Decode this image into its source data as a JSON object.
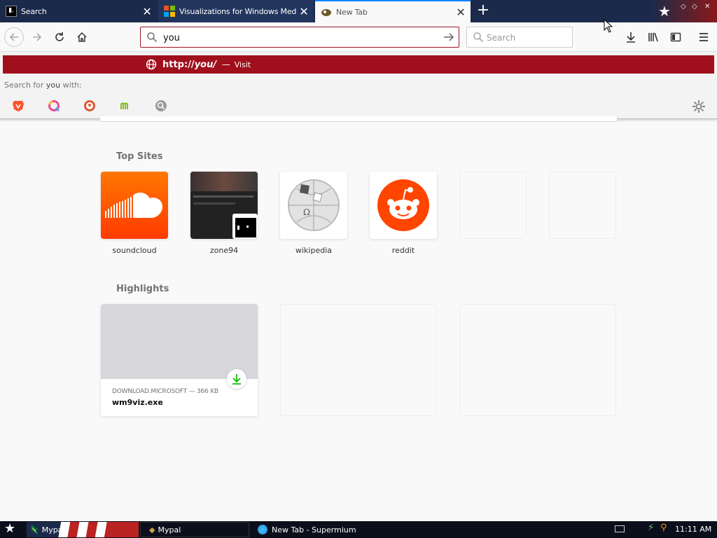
{
  "tabs": [
    {
      "title": "Search",
      "icon": "terminal-icon"
    },
    {
      "title": "Visualizations for Windows Media Player",
      "icon": "windows-logo-icon"
    },
    {
      "title": "New Tab",
      "icon": "browser-icon"
    }
  ],
  "urlbar": {
    "value": "you"
  },
  "searchbar": {
    "placeholder": "Search"
  },
  "dropdown": {
    "visit_url_prefix": "http://",
    "visit_url_bold": "you/",
    "visit_sep": " — ",
    "visit_label": "Visit",
    "search_for_prefix": "Search for ",
    "search_for_term": "you",
    "search_for_suffix": " with:",
    "engines": [
      "brave-icon",
      "qwant-icon",
      "duckduckgo-icon",
      "mojeek-icon",
      "magnifier-engine-icon"
    ]
  },
  "top_sites": {
    "title": "Top Sites",
    "items": [
      {
        "label": "soundcloud"
      },
      {
        "label": "zone94"
      },
      {
        "label": "wikipedia"
      },
      {
        "label": "reddit"
      },
      {
        "label": ""
      },
      {
        "label": ""
      }
    ]
  },
  "highlights": {
    "title": "Highlights",
    "item": {
      "source": "DOWNLOAD.MICROSOFT — 366 KB",
      "title": "wm9viz.exe"
    }
  },
  "taskbar": {
    "items": [
      {
        "label": "Mypal"
      },
      {
        "label": "Mypal"
      },
      {
        "label": "New Tab - Supermium"
      }
    ],
    "clock": "11:11 AM"
  },
  "colors": {
    "accent_red": "#a0101c",
    "tab_blue": "#1b2a4a",
    "soundcloud": "#ff5500",
    "reddit": "#ff4500"
  }
}
